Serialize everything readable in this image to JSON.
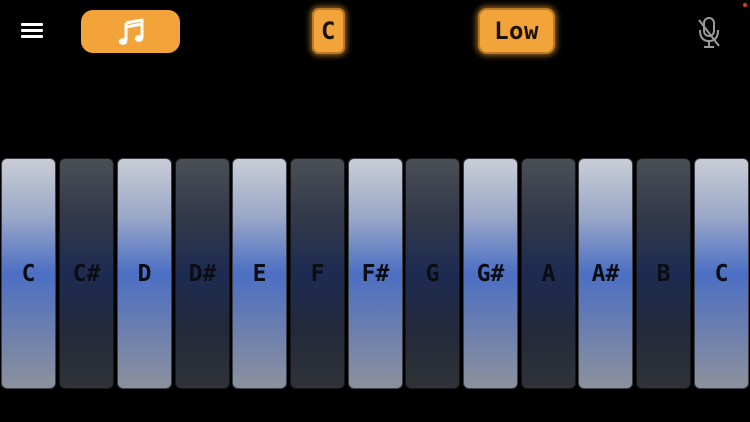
{
  "toolbar": {
    "menu_icon": "hamburger-menu-icon",
    "music_icon": "music-note-icon",
    "key_label": "C",
    "octave_label": "Low",
    "mic_icon": "microphone-muted-icon",
    "accent_color": "#f2a33a",
    "indicator_color": "#e23b2e"
  },
  "keys": [
    {
      "label": "C",
      "style": "light"
    },
    {
      "label": "C#",
      "style": "dark"
    },
    {
      "label": "D",
      "style": "light"
    },
    {
      "label": "D#",
      "style": "dark"
    },
    {
      "label": "E",
      "style": "light"
    },
    {
      "label": "F",
      "style": "dark"
    },
    {
      "label": "F#",
      "style": "light"
    },
    {
      "label": "G",
      "style": "dark"
    },
    {
      "label": "G#",
      "style": "light"
    },
    {
      "label": "A",
      "style": "dark"
    },
    {
      "label": "A#",
      "style": "light"
    },
    {
      "label": "B",
      "style": "dark"
    },
    {
      "label": "C",
      "style": "light"
    }
  ]
}
